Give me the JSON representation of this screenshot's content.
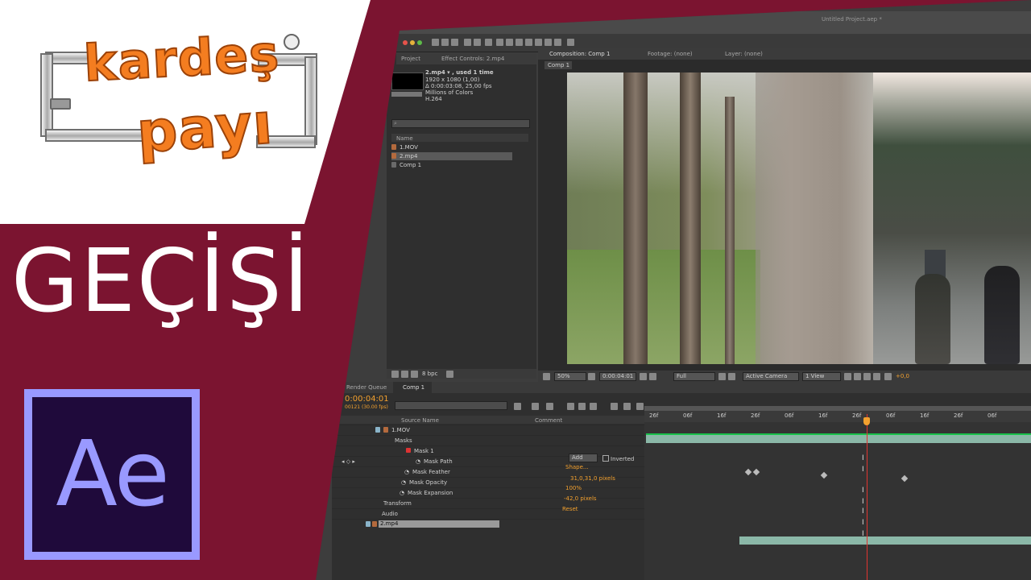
{
  "branding": {
    "logo_line1": "kardeş",
    "logo_line2": "payı",
    "headline": "GEÇİŞİ",
    "ae_logo": "Ae",
    "colors": {
      "bg": "#7b1430",
      "logo_orange": "#f47d20",
      "ae_purple": "#9999ff",
      "ae_dark": "#1f0a3b"
    }
  },
  "window": {
    "title": "Untitled Project.aep *"
  },
  "project_panel": {
    "tab_project": "Project",
    "tab_effect": "Effect Controls: 2.mp4",
    "info_name": "2.mp4 ▾ , used 1 time",
    "info_res": "1920 x 1080 (1,00)",
    "info_dur": "Δ 0:00:03:08, 25,00 fps",
    "info_colors": "Millions of Colors",
    "info_codec": "H.264",
    "col_name": "Name",
    "items": [
      {
        "label": "1.MOV"
      },
      {
        "label": "2.mp4"
      },
      {
        "label": "Comp 1"
      }
    ],
    "bpc": "8 bpc"
  },
  "viewer": {
    "tab_comp": "Composition: Comp 1",
    "tab_footage": "Footage: (none)",
    "tab_layer": "Layer: (none)",
    "comp_label": "Comp 1",
    "zoom": "50%",
    "timecode": "0:00:04:01",
    "resolution": "Full",
    "camera": "Active Camera",
    "view": "1 View",
    "exposure": "+0,0"
  },
  "timeline": {
    "tab_render": "Render Queue",
    "tab_comp": "Comp 1",
    "timecode": "0:00:04:01",
    "frames": "00121 (30.00 fps)",
    "col_source": "Source Name",
    "col_comment": "Comment",
    "layers": [
      {
        "name": "1.MOV"
      },
      {
        "name": "2.mp4"
      }
    ],
    "masks_label": "Masks",
    "mask1": "Mask 1",
    "props": [
      {
        "name": "Mask Path",
        "value": "Shape..."
      },
      {
        "name": "Mask Feather",
        "value": "31,0,31,0 pixels"
      },
      {
        "name": "Mask Opacity",
        "value": "100%"
      },
      {
        "name": "Mask Expansion",
        "value": "-42,0 pixels"
      }
    ],
    "transform": "Transform",
    "audio": "Audio",
    "reset": "Reset",
    "mode": "Add",
    "inverted": "Inverted",
    "ruler": [
      "26f",
      "06f",
      "16f",
      "26f",
      "06f",
      "16f",
      "26f",
      "06f",
      "16f",
      "26f",
      "06f"
    ]
  }
}
